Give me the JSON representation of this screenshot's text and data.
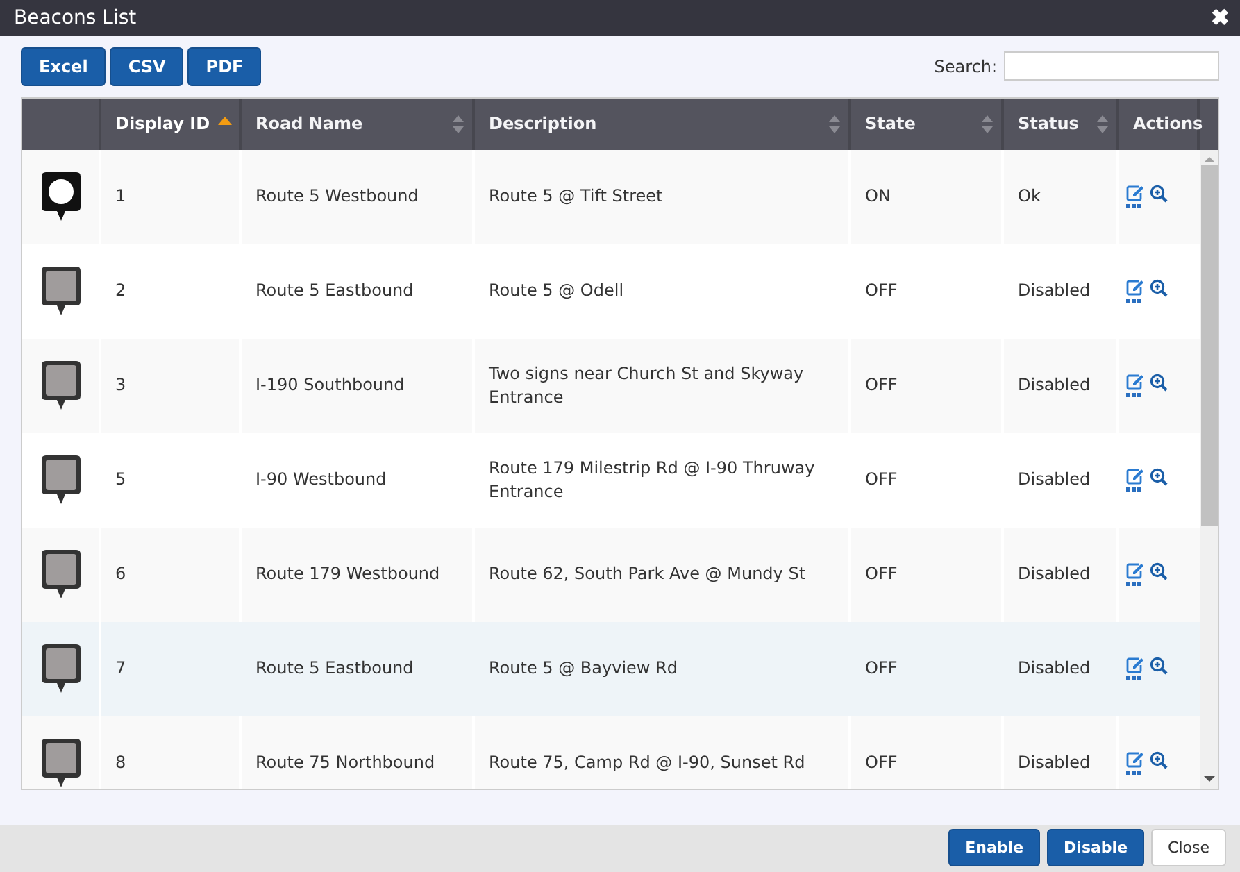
{
  "window": {
    "title": "Beacons List",
    "close": "✖"
  },
  "export_buttons": [
    "Excel",
    "CSV",
    "PDF"
  ],
  "search": {
    "label": "Search:"
  },
  "table": {
    "columns": [
      {
        "kind": "plain"
      },
      {
        "label": "Display ID",
        "kind": "sortable",
        "sorted": true
      },
      {
        "label": "Road Name",
        "kind": "sortable",
        "sorted": false
      },
      {
        "label": "Description",
        "kind": "sortable",
        "sorted": false
      },
      {
        "label": "State",
        "kind": "sortable",
        "sorted": false
      },
      {
        "label": "Status",
        "kind": "sortable",
        "sorted": false
      },
      {
        "label": "Actions",
        "kind": "plain"
      }
    ],
    "rows": [
      {
        "lit": true,
        "selected": false,
        "id": "1",
        "road": "Route 5 Westbound",
        "description": "Route 5 @ Tift Street",
        "state": "ON",
        "status": "Ok"
      },
      {
        "lit": false,
        "selected": false,
        "id": "2",
        "road": "Route 5 Eastbound",
        "description": "Route 5 @ Odell",
        "state": "OFF",
        "status": "Disabled"
      },
      {
        "lit": false,
        "selected": false,
        "id": "3",
        "road": "I-190 Southbound",
        "description": "Two signs near Church St and Skyway Entrance",
        "state": "OFF",
        "status": "Disabled"
      },
      {
        "lit": false,
        "selected": false,
        "id": "5",
        "road": "I-90 Westbound",
        "description": "Route 179 Milestrip Rd @ I-90 Thruway Entrance",
        "state": "OFF",
        "status": "Disabled"
      },
      {
        "lit": false,
        "selected": false,
        "id": "6",
        "road": "Route 179 Westbound",
        "description": "Route 62, South Park Ave @ Mundy St",
        "state": "OFF",
        "status": "Disabled"
      },
      {
        "lit": false,
        "selected": true,
        "id": "7",
        "road": "Route 5 Eastbound",
        "description": "Route 5 @ Bayview Rd",
        "state": "OFF",
        "status": "Disabled"
      },
      {
        "lit": false,
        "selected": false,
        "id": "8",
        "road": "Route 75 Northbound",
        "description": "Route 75, Camp Rd @ I-90, Sunset Rd",
        "state": "OFF",
        "status": "Disabled"
      }
    ]
  },
  "footer_buttons": [
    {
      "label": "Enable",
      "kind": "primary"
    },
    {
      "label": "Disable",
      "kind": "primary"
    },
    {
      "label": "Close",
      "kind": "plain"
    }
  ]
}
